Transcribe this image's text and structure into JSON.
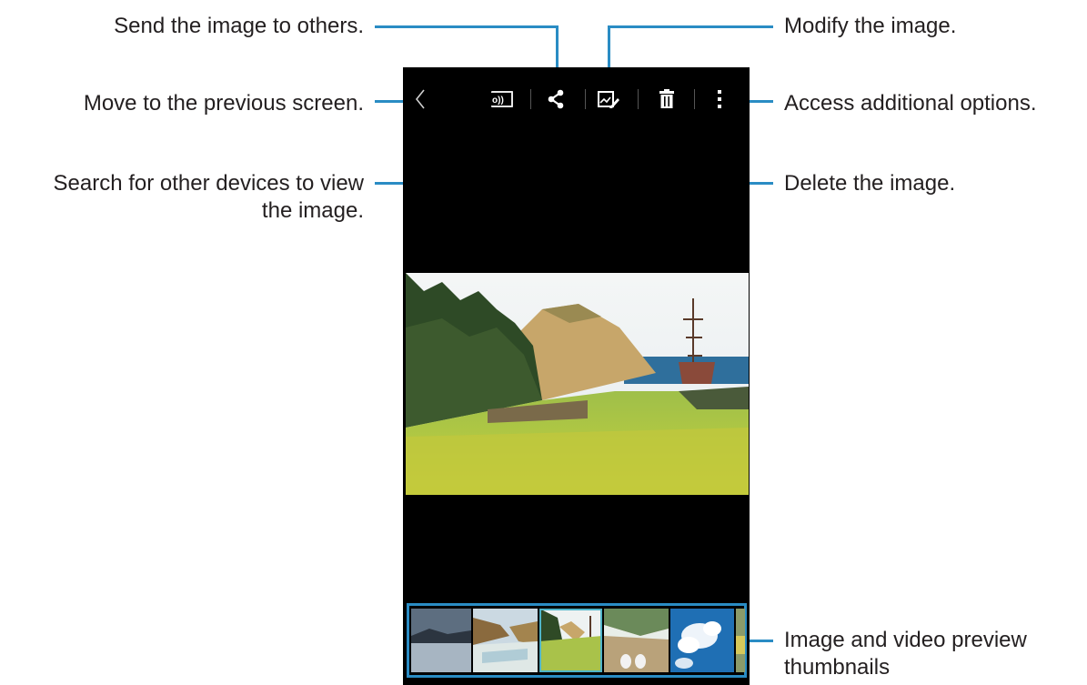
{
  "callouts": {
    "send": "Send the image to others.",
    "previous": "Move to the previous screen.",
    "search_line1": "Search for other devices to view",
    "search_line2": "the image.",
    "modify": "Modify the image.",
    "options": "Access additional options.",
    "delete": "Delete the image.",
    "thumbs_line1": "Image and video preview",
    "thumbs_line2": "thumbnails"
  },
  "action_bar": {
    "icons": [
      "back-icon",
      "screen-mirroring-icon",
      "share-icon",
      "edit-icon",
      "delete-icon",
      "more-options-icon"
    ],
    "screen_mirroring_glyph": "o))"
  },
  "colors": {
    "callout_line": "#2a8cc4",
    "screen_bg": "#000000",
    "selected_thumb": "#4fb4c8"
  },
  "thumbnails": {
    "count_visible": 6,
    "selected_index": 2,
    "items": [
      "lake-landscape",
      "coast-cliffs",
      "green-field-ship",
      "feet-on-beach",
      "clouds-sky",
      "partial-thumbnail"
    ]
  }
}
